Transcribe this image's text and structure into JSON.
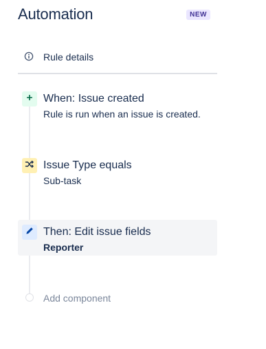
{
  "header": {
    "title": "Automation",
    "badge": "NEW"
  },
  "rule_details": {
    "label": "Rule details",
    "icon": "info-icon"
  },
  "steps": [
    {
      "title": "When: Issue created",
      "subtitle": "Rule is run when an issue is created.",
      "icon": "plus-icon",
      "color": "#e3fcef",
      "icon_color": "#006644",
      "selected": false
    },
    {
      "title": "Issue Type equals",
      "subtitle": "Sub-task",
      "icon": "shuffle-icon",
      "color": "#fff0b3",
      "icon_color": "#172b4d",
      "selected": false
    },
    {
      "title": "Then: Edit issue fields",
      "subtitle": "Reporter",
      "icon": "pencil-icon",
      "color": "#deebff",
      "icon_color": "#0747a6",
      "selected": true
    }
  ],
  "add_component": {
    "label": "Add component"
  }
}
